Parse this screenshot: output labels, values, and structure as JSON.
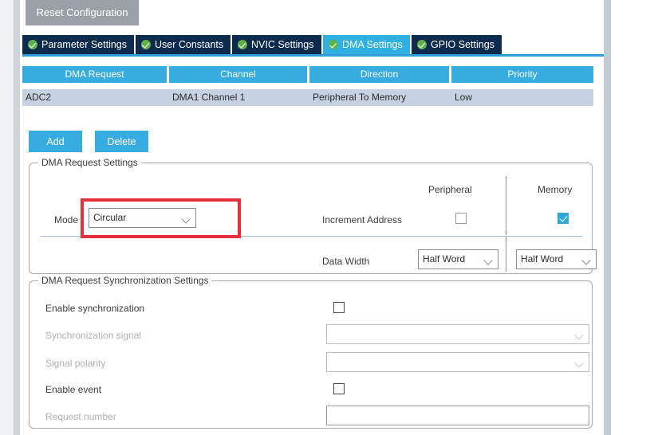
{
  "toolbar": {
    "reset_label": "Reset Configuration"
  },
  "tabs": [
    {
      "label": "Parameter Settings",
      "icon": "check-circle-icon",
      "active": false
    },
    {
      "label": "User Constants",
      "icon": "check-circle-icon",
      "active": false
    },
    {
      "label": "NVIC Settings",
      "icon": "check-circle-icon",
      "active": false
    },
    {
      "label": "DMA Settings",
      "icon": "check-circle-icon",
      "active": true
    },
    {
      "label": "GPIO Settings",
      "icon": "check-circle-icon",
      "active": false
    }
  ],
  "request_table": {
    "columns": [
      "DMA Request",
      "Channel",
      "Direction",
      "Priority"
    ],
    "rows": [
      {
        "dma_request": "ADC2",
        "channel": "DMA1 Channel 1",
        "direction": "Peripheral To Memory",
        "priority": "Low"
      }
    ]
  },
  "actions": {
    "add_label": "Add",
    "delete_label": "Delete"
  },
  "request_settings": {
    "legend": "DMA Request Settings",
    "column_headers": {
      "peripheral": "Peripheral",
      "memory": "Memory"
    },
    "mode": {
      "label": "Mode",
      "value": "Circular"
    },
    "increment_address": {
      "label": "Increment Address",
      "peripheral_checked": false,
      "memory_checked": true
    },
    "data_width": {
      "label": "Data Width",
      "peripheral_value": "Half Word",
      "memory_value": "Half Word"
    }
  },
  "sync_settings": {
    "legend": "DMA Request Synchronization Settings",
    "enable_synchronization": {
      "label": "Enable synchronization",
      "checked": false,
      "disabled": false
    },
    "synchronization_signal": {
      "label": "Synchronization signal",
      "value": "",
      "disabled": true
    },
    "signal_polarity": {
      "label": "Signal polarity",
      "value": "",
      "disabled": true
    },
    "enable_event": {
      "label": "Enable event",
      "checked": false,
      "disabled": false
    },
    "request_number": {
      "label": "Request number",
      "value": "",
      "disabled": true
    }
  },
  "annotation": {
    "highlight_color": "#e8303a",
    "target": "mode-dropdown"
  },
  "colors": {
    "tab_active": "#2fb0e3",
    "tab_inactive": "#0d2b4e",
    "table_header": "#36ace0",
    "table_row": "#c6d2e2",
    "button_primary": "#36ace0",
    "button_reset": "#9ba0a6",
    "checkbox_checked": "#2fa8dd"
  }
}
